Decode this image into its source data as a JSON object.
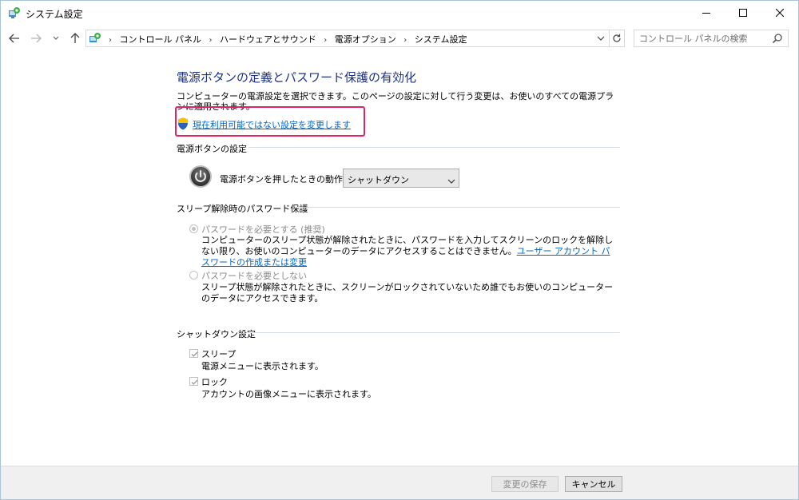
{
  "window": {
    "title": "システム設定"
  },
  "navigation": {
    "breadcrumbs": [
      "コントロール パネル",
      "ハードウェアとサウンド",
      "電源オプション",
      "システム設定"
    ],
    "search_placeholder": "コントロール パネルの検索"
  },
  "main": {
    "title": "電源ボタンの定義とパスワード保護の有効化",
    "description": "コンピューターの電源設定を選択できます。このページの設定に対して行う変更は、お使いのすべての電源プランに適用されます。",
    "change_unavailable_link": "現在利用可能ではない設定を変更します",
    "power_button_section": {
      "heading": "電源ボタンの設定",
      "action_label": "電源ボタンを押したときの動作:",
      "action_value": "シャットダウン"
    },
    "password_section": {
      "heading": "スリープ解除時のパスワード保護",
      "require_label": "パスワードを必要とする (推奨)",
      "require_desc": "コンピューターのスリープ状態が解除されたときに、パスワードを入力してスクリーンのロックを解除しない限り、お使いのコンピューターのデータにアクセスすることはできません。",
      "account_link": "ユーザー アカウント パスワードの作成または変更",
      "no_require_label": "パスワードを必要としない",
      "no_require_desc": "スリープ状態が解除されたときに、スクリーンがロックされていないため誰でもお使いのコンピューターのデータにアクセスできます。"
    },
    "shutdown_section": {
      "heading": "シャットダウン設定",
      "sleep_label": "スリープ",
      "sleep_desc": "電源メニューに表示されます。",
      "lock_label": "ロック",
      "lock_desc": "アカウントの画像メニューに表示されます。"
    }
  },
  "footer": {
    "save_label": "変更の保存",
    "cancel_label": "キャンセル"
  },
  "colors": {
    "title_blue": "#1e3287",
    "link_blue": "#0066cc",
    "highlight": "#e0245e"
  }
}
